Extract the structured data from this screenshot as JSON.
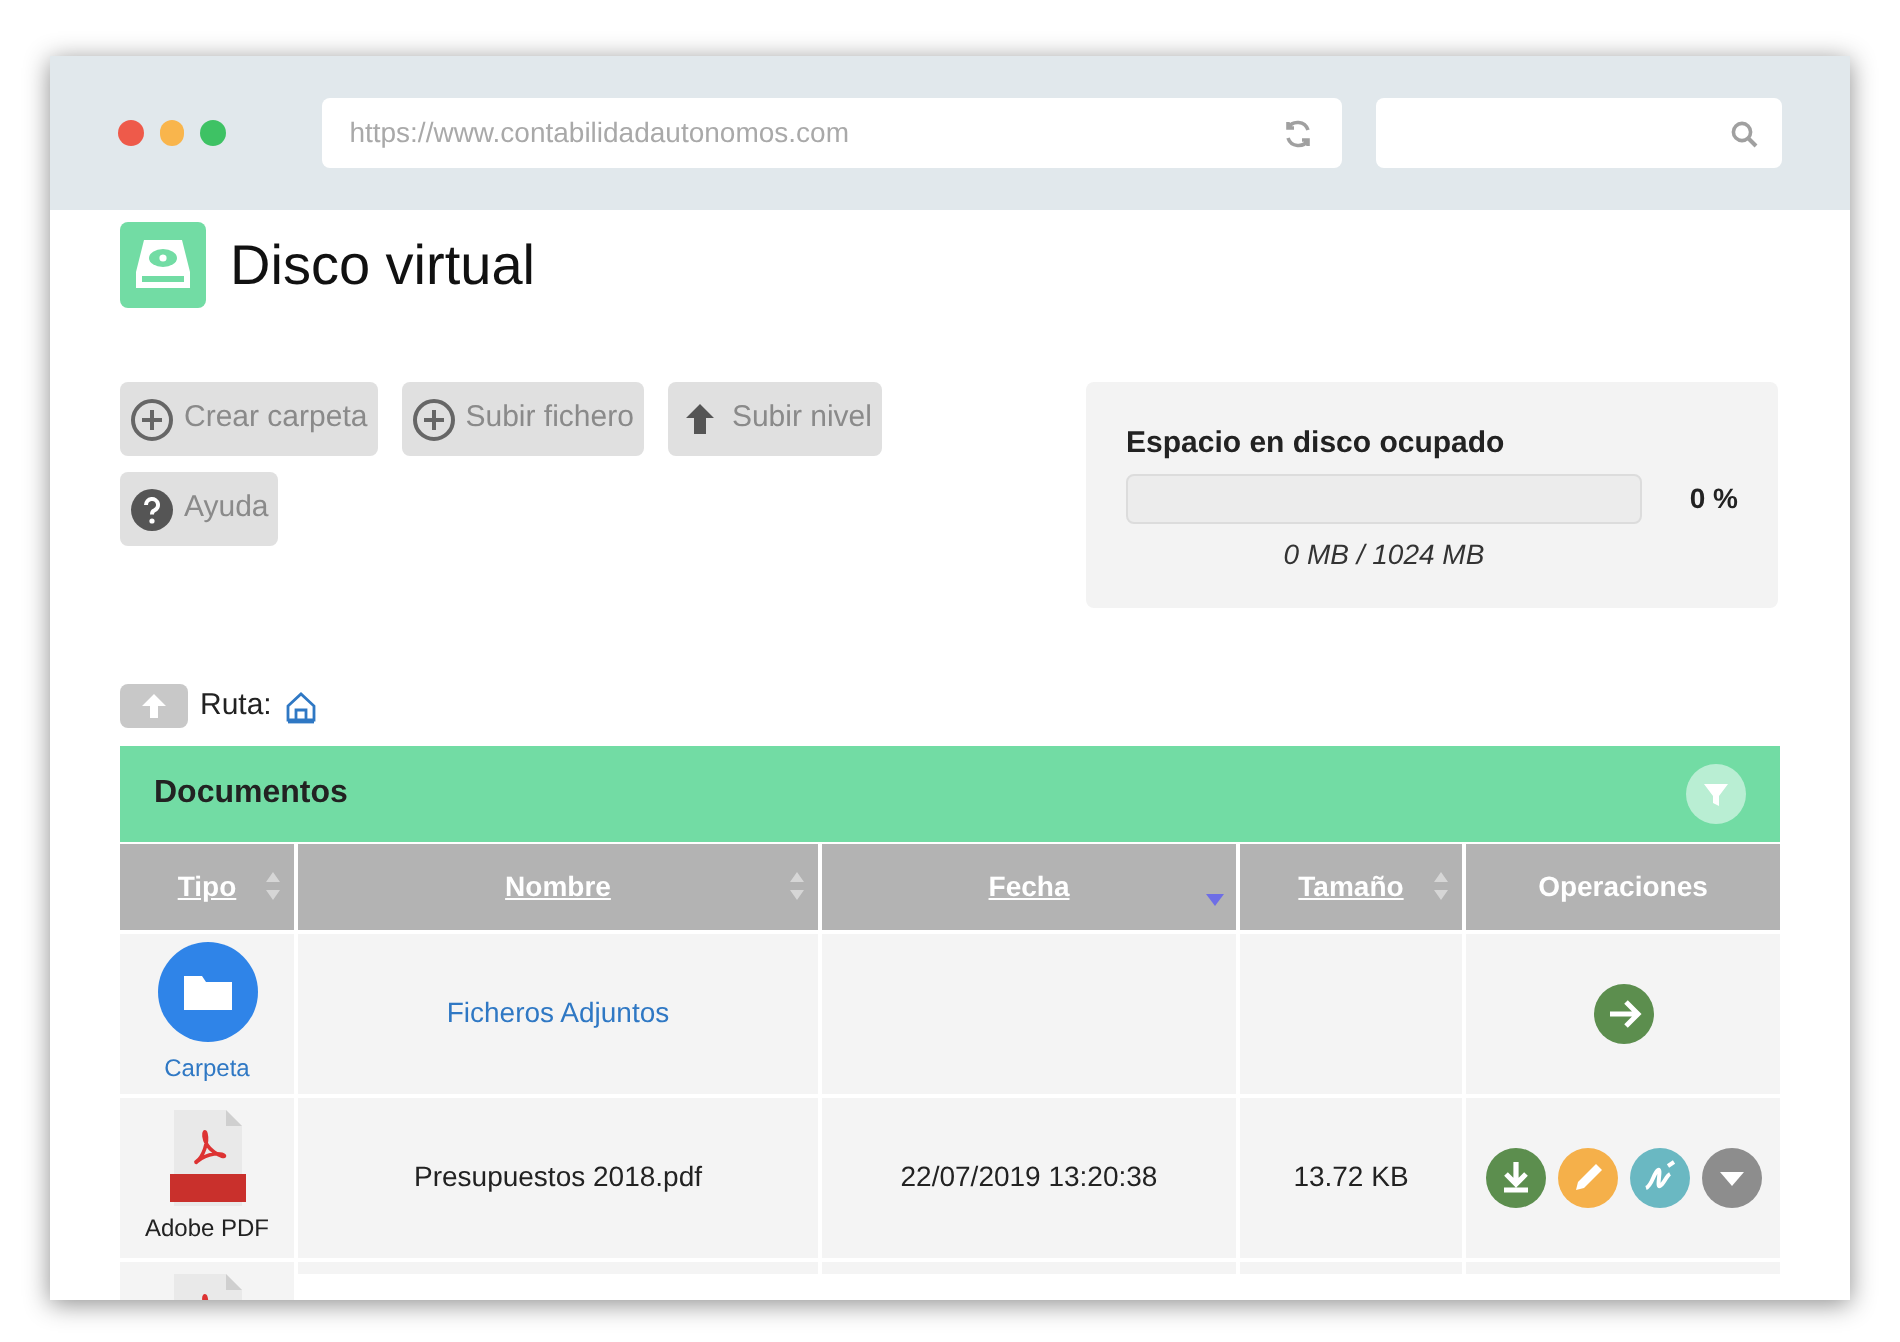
{
  "browser": {
    "url": "https://www.contabilidadautonomos.com"
  },
  "page": {
    "title": "Disco virtual"
  },
  "toolbar": [
    {
      "kind": "plus",
      "label": "Crear carpeta"
    },
    {
      "kind": "plus",
      "label": "Subir fichero"
    },
    {
      "kind": "up",
      "label": "Subir nivel"
    },
    {
      "kind": "help",
      "label": "Ayuda"
    }
  ],
  "disk_usage": {
    "title": "Espacio en disco ocupado",
    "level": 0,
    "percent": "0 %",
    "detail": "0 MB / 1024 MB"
  },
  "path": {
    "label": "Ruta:"
  },
  "panel": {
    "title": "Documentos"
  },
  "table": {
    "columns": [
      {
        "label": "Tipo",
        "sortable": true,
        "sorted": false
      },
      {
        "label": "Nombre",
        "sortable": true,
        "sorted": false
      },
      {
        "label": "Fecha",
        "sortable": true,
        "sorted": true
      },
      {
        "label": "Tamaño",
        "sortable": true,
        "sorted": false
      },
      {
        "label": "Operaciones",
        "sortable": false,
        "sorted": false
      }
    ],
    "rows": [
      {
        "kind": "folder",
        "type": "Carpeta",
        "name": "Ficheros Adjuntos",
        "actions": [
          {
            "kind": "open"
          }
        ]
      },
      {
        "kind": "pdf",
        "type": "Adobe PDF",
        "name": "Presupuestos 2018.pdf",
        "date": "22/07/2019 13:20:38",
        "size": "13.72 KB",
        "actions": [
          {
            "kind": "download"
          },
          {
            "kind": "edit"
          },
          {
            "kind": "sign"
          },
          {
            "kind": "more"
          }
        ]
      },
      {
        "kind": "pdf"
      }
    ]
  }
}
